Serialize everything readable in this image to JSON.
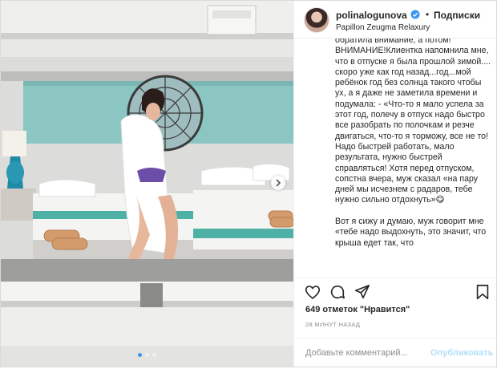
{
  "post": {
    "dots_total": 3,
    "dots_active": 0,
    "next_icon": "chevron-right-icon"
  },
  "header": {
    "username": "polinalogunova",
    "verified_icon": "verified-badge-icon",
    "separator": "•",
    "follow_label": "Подписки",
    "location": "Papillon Zeugma Relaxury"
  },
  "caption": {
    "text": "обратила внимание, а потом! ВНИМАНИЕ!Клиентка напомнила мне, что в отпуске я была прошлой зимой.... скоро уже как год назад...год...мой ребёнок год без солнца такого чтобы ух, а я даже не заметила времени и подумала: - «Что-то я мало успела за этот год, полечу в отпуск надо быстро все разобрать по полочкам и резче двигаться, что-то я торможу, все не то! Надо быстрей работать, мало результата, нужно быстрей справляться! Хотя перед отпуском, сопстна вчера, муж сказал «на пару дней мы исчезнем с радаров, тебе нужно сильно отдохнуть»😋\n\nВот я сижу и думаю, муж говорит мне «тебе надо выдохнуть, это значит, что крыша едет так, что"
  },
  "actions": {
    "icons": [
      "heart-icon",
      "comment-icon",
      "share-icon",
      "bookmark-icon"
    ],
    "likes": "649 отметок \"Нравится\"",
    "time": "28 МИНУТ НАЗАД"
  },
  "comment": {
    "placeholder": "Добавьте комментарий...",
    "publish_label": "Опубликовать"
  },
  "colors": {
    "accent": "#3897f0",
    "publish_disabled": "#b2dffc",
    "verified": "#3897f0",
    "border": "#efefef"
  }
}
